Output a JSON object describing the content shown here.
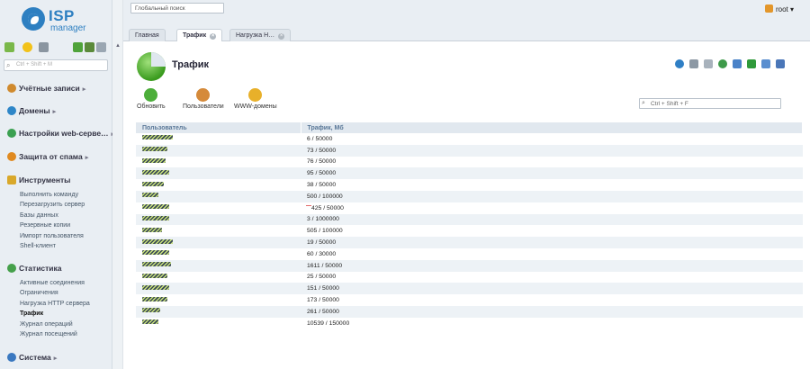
{
  "logo": {
    "text": "ISP",
    "sub": "manager"
  },
  "sidebar": {
    "search_placeholder": "Ctrl + Shift + M",
    "groups": [
      {
        "label": "Учётные записи",
        "arrow": "▸",
        "color": "#d08a2e"
      },
      {
        "label": "Домены",
        "arrow": "▸",
        "color": "#2e86c8"
      },
      {
        "label": "Настройки web-серве…",
        "arrow": "▸",
        "color": "#3aa050"
      },
      {
        "label": "Защита от спама",
        "arrow": "▸",
        "color": "#e08a20"
      },
      {
        "label": "Инструменты",
        "arrow": "",
        "color": "#d9a82a"
      },
      {
        "label": "Статистика",
        "arrow": "",
        "color": "#45a04a"
      },
      {
        "label": "Система",
        "arrow": "▸",
        "color": "#3a78c0"
      }
    ],
    "tools_items": [
      "Выполнить команду",
      "Перезагрузить сервер",
      "Базы данных",
      "Резервные копии",
      "Импорт пользователя",
      "Shell-клиент"
    ],
    "stats_items": [
      "Активные соединения",
      "Ограничения",
      "Нагрузка HTTP сервера",
      "Трафик",
      "Журнал операций",
      "Журнал посещений"
    ]
  },
  "topbar": {
    "global_search_placeholder": "Глобальный поиск",
    "user": "root",
    "user_arrow": "▾"
  },
  "tabs": [
    {
      "label": "Главная"
    },
    {
      "label": "Трафик"
    },
    {
      "label": "Нагрузка Н…"
    }
  ],
  "page": {
    "title": "Трафик"
  },
  "toolbar": {
    "refresh_label": "Обновить",
    "users_label": "Пользователи",
    "www_label": "WWW-домены",
    "search_placeholder": "Ctrl + Shift + F"
  },
  "table": {
    "headers": [
      "Пользователь",
      "Трафик, Мб"
    ],
    "rows": [
      "6 / 50000",
      "73 / 50000",
      "76 / 50000",
      "95 / 50000",
      "38 / 50000",
      "500 / 100000",
      "425 / 50000",
      "3 / 1000000",
      "505 / 100000",
      "19 / 50000",
      "60 / 30000",
      "1611 / 50000",
      "25 / 50000",
      "151 / 50000",
      "173 / 50000",
      "261 / 50000",
      "10539 / 150000"
    ]
  }
}
